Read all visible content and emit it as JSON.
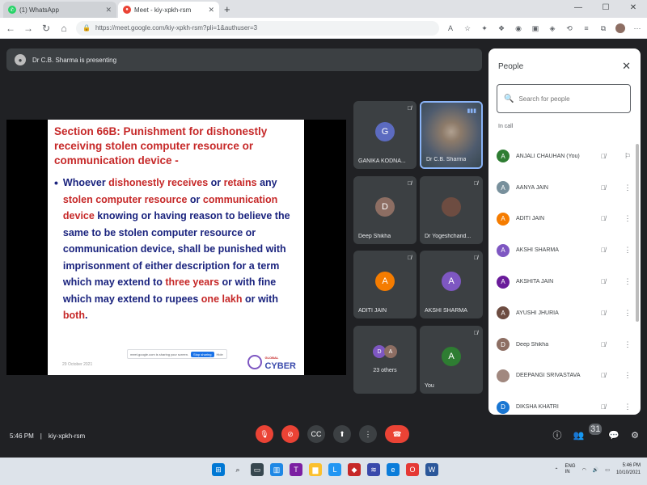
{
  "browser": {
    "tabs": [
      {
        "title": "(1) WhatsApp",
        "fav": "whatsapp-icon",
        "active": false
      },
      {
        "title": "Meet - kiy-xpkh-rsm",
        "fav": "meet-icon",
        "active": true
      }
    ],
    "url": "https://meet.google.com/kiy-xpkh-rsm?pli=1&authuser=3"
  },
  "meeting": {
    "presenting_label": "Dr C.B. Sharma is presenting",
    "time": "5:46 PM",
    "code": "kiy-xpkh-rsm",
    "people_count": "31"
  },
  "slide": {
    "title": "Section 66B:  Punishment for dishonestly receiving stolen computer resource or communication device -",
    "bullet": "•",
    "body": [
      {
        "t": "Whoever ",
        "hl": false
      },
      {
        "t": "dishonestly receives",
        "hl": true
      },
      {
        "t": " or ",
        "hl": false
      },
      {
        "t": "retains",
        "hl": true
      },
      {
        "t": " any ",
        "hl": false
      },
      {
        "t": "stolen computer resource",
        "hl": true
      },
      {
        "t": " or ",
        "hl": false
      },
      {
        "t": "communication device",
        "hl": true
      },
      {
        "t": " knowing or having reason to believe the same to be stolen computer resource or communication device, shall be punished with imprisonment of either description for a term which may extend to ",
        "hl": false
      },
      {
        "t": "three years",
        "hl": true
      },
      {
        "t": " or with fine which may extend to rupees ",
        "hl": false
      },
      {
        "t": "one lakh",
        "hl": true
      },
      {
        "t": " or with ",
        "hl": false
      },
      {
        "t": "both",
        "hl": true
      },
      {
        "t": ".",
        "hl": false
      }
    ],
    "footer": "29 October 2021",
    "share_text": "meet.google.com is sharing your screen.",
    "stop_sharing": "Stop sharing",
    "hide": "Hide",
    "logo_top": "GLOBAL",
    "logo_main": "CYBER"
  },
  "tiles": [
    {
      "name": "GANIKA KODNA...",
      "initial": "G",
      "color": "#5c6bc0"
    },
    {
      "name": "Dr C.B. Sharma",
      "initial": "",
      "color": ""
    },
    {
      "name": "Deep Shikha",
      "initial": "D",
      "color": "#8d6e63"
    },
    {
      "name": "Dr Yogeshchand...",
      "initial": "",
      "color": "#6d4c41"
    },
    {
      "name": "ADITI JAIN",
      "initial": "A",
      "color": "#f57c00"
    },
    {
      "name": "AKSHI SHARMA",
      "initial": "A",
      "color": "#7e57c2"
    },
    {
      "name": "23 others",
      "initial": "",
      "color": ""
    },
    {
      "name": "You",
      "initial": "A",
      "color": "#2e7d32"
    }
  ],
  "others_minis": [
    {
      "initial": "D",
      "color": "#7e57c2"
    },
    {
      "initial": "A",
      "color": "#8d6e63"
    }
  ],
  "people_panel": {
    "title": "People",
    "search_placeholder": "Search for people",
    "section": "In call",
    "list": [
      {
        "name": "ANJALI CHAUHAN (You)",
        "initial": "A",
        "color": "#2e7d32"
      },
      {
        "name": "AANYA JAIN",
        "initial": "A",
        "color": "#78909c"
      },
      {
        "name": "ADITI JAIN",
        "initial": "A",
        "color": "#f57c00"
      },
      {
        "name": "AKSHI SHARMA",
        "initial": "A",
        "color": "#7e57c2"
      },
      {
        "name": "AKSHITA JAIN",
        "initial": "A",
        "color": "#6a1b9a"
      },
      {
        "name": "AYUSHI JHURIA",
        "initial": "A",
        "color": "#6d4c41"
      },
      {
        "name": "Deep Shikha",
        "initial": "D",
        "color": "#8d6e63"
      },
      {
        "name": "DEEPANGI SRIVASTAVA",
        "initial": "",
        "color": "#a1887f"
      },
      {
        "name": "DIKSHA KHATRI",
        "initial": "D",
        "color": "#1976d2"
      }
    ]
  },
  "taskbar": {
    "lang": "ENG\nIN",
    "clock_time": "5:46 PM",
    "clock_date": "10/10/2021"
  }
}
